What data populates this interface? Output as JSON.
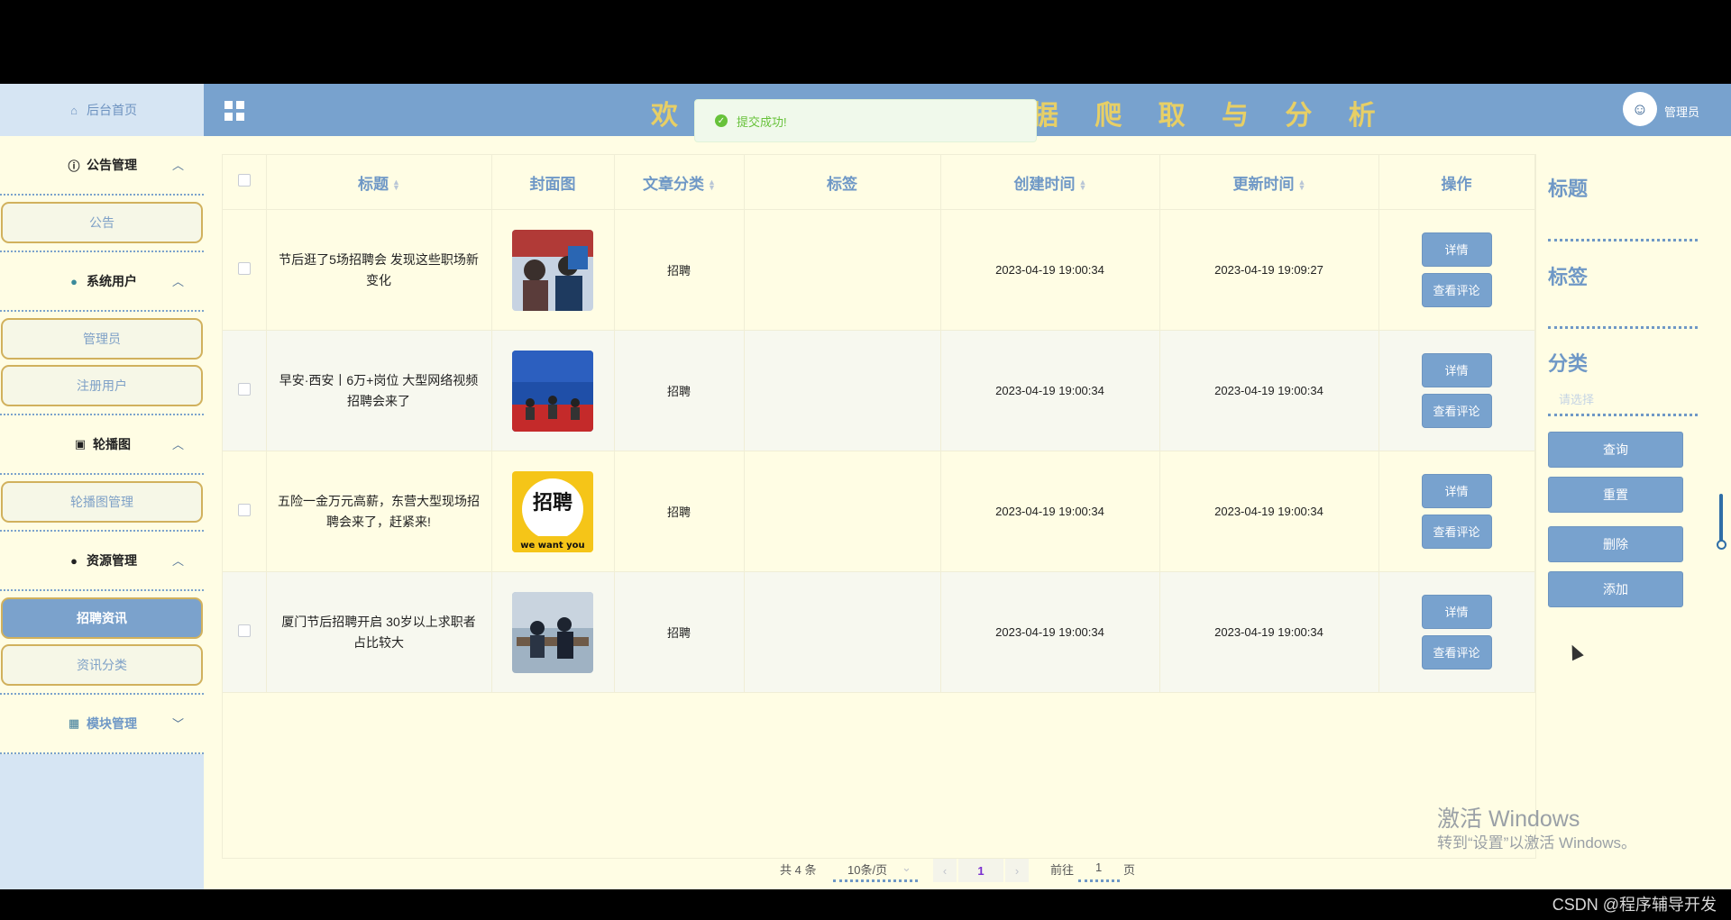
{
  "sidebar": {
    "home": "后台首页",
    "groups": [
      {
        "label": "公告管理",
        "icon": "info-icon",
        "items": [
          "公告"
        ]
      },
      {
        "label": "系统用户",
        "icon": "user-icon",
        "items": [
          "管理员",
          "注册用户"
        ]
      },
      {
        "label": "轮播图",
        "icon": "image-icon",
        "items": [
          "轮播图管理"
        ]
      },
      {
        "label": "资源管理",
        "icon": "location-icon",
        "items": [
          "招聘资讯",
          "资讯分类"
        ]
      },
      {
        "label": "模块管理",
        "icon": "grid-icon",
        "items": []
      }
    ]
  },
  "header": {
    "banner_visible": "欢 迎 使 用 … 数 据 爬 取 与 分 析",
    "user": "管理员"
  },
  "toast": "提交成功!",
  "table": {
    "columns": [
      "标题",
      "封面图",
      "文章分类",
      "标签",
      "创建时间",
      "更新时间",
      "操作"
    ],
    "rows": [
      {
        "title": "节后逛了5场招聘会 发现这些职场新变化",
        "category": "招聘",
        "tags": "",
        "created": "2023-04-19 19:00:34",
        "updated": "2023-04-19 19:09:27",
        "thumb": "photo-job-fair"
      },
      {
        "title": "早安·西安丨6万+岗位 大型网络视频招聘会来了",
        "category": "招聘",
        "tags": "",
        "created": "2023-04-19 19:00:34",
        "updated": "2023-04-19 19:00:34",
        "thumb": "photo-stage"
      },
      {
        "title": "五险一金万元高薪，东营大型现场招聘会来了，赶紧来!",
        "category": "招聘",
        "tags": "",
        "created": "2023-04-19 19:00:34",
        "updated": "2023-04-19 19:00:34",
        "thumb": "poster-zhaopin"
      },
      {
        "title": "厦门节后招聘开启 30岁以上求职者占比较大",
        "category": "招聘",
        "tags": "",
        "created": "2023-04-19 19:00:34",
        "updated": "2023-04-19 19:00:34",
        "thumb": "photo-office"
      }
    ],
    "detail_label": "详情",
    "comment_label": "查看评论",
    "poster_text": "招聘",
    "poster_sub": "we want you"
  },
  "search": {
    "title_label": "标题",
    "tag_label": "标签",
    "category_label": "分类",
    "category_placeholder": "请选择",
    "query": "查询",
    "reset": "重置",
    "delete": "删除",
    "add": "添加"
  },
  "pagination": {
    "total": "共 4 条",
    "page_size": "10条/页",
    "current": "1",
    "goto": "前往",
    "page_input": "1",
    "page_unit": "页"
  },
  "watermark": {
    "line1": "激活 Windows",
    "line2": "转到“设置”以激活 Windows。"
  },
  "csdn": "CSDN @程序辅导开发",
  "colors": {
    "accent": "#78a2ce",
    "background": "#fffde4",
    "gold": "#d1b15d",
    "success": "#67c23a"
  }
}
